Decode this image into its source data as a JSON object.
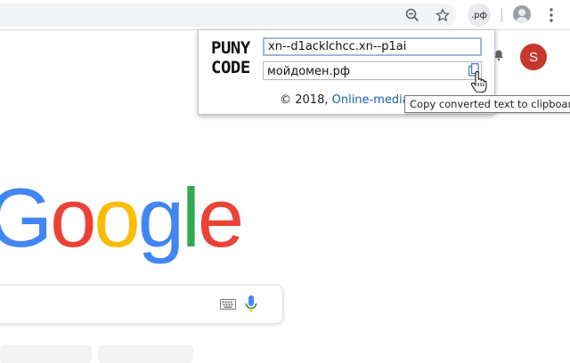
{
  "browser": {
    "extension_badge": ".рф",
    "zoom_icon": "zoom-out-icon",
    "bookmark_icon": "star-icon",
    "menu_icon": "more-vertical-icon",
    "profile_icon": "profile-icon"
  },
  "popup": {
    "logo_line1": "PUNY",
    "logo_line2": "CODE",
    "punycode_value": "xn--d1acklchcc.xn--p1ai",
    "unicode_value": "мойдомен.рф",
    "copy_icon": "copy-icon",
    "footer_copyright": "© 2018, ",
    "footer_link": "Online-media.",
    "tooltip": "Copy converted text to clipboard"
  },
  "google": {
    "avatar_letter": "S",
    "logo_letters": [
      "G",
      "o",
      "o",
      "g",
      "l",
      "e"
    ],
    "logo_colors": [
      "#4285f4",
      "#ea4335",
      "#fbbc05",
      "#4285f4",
      "#34a853",
      "#ea4335"
    ]
  },
  "colors": {
    "avatar_bg": "#c5382c",
    "link": "#1a62a8",
    "active_field_border": "#9cbad9"
  }
}
